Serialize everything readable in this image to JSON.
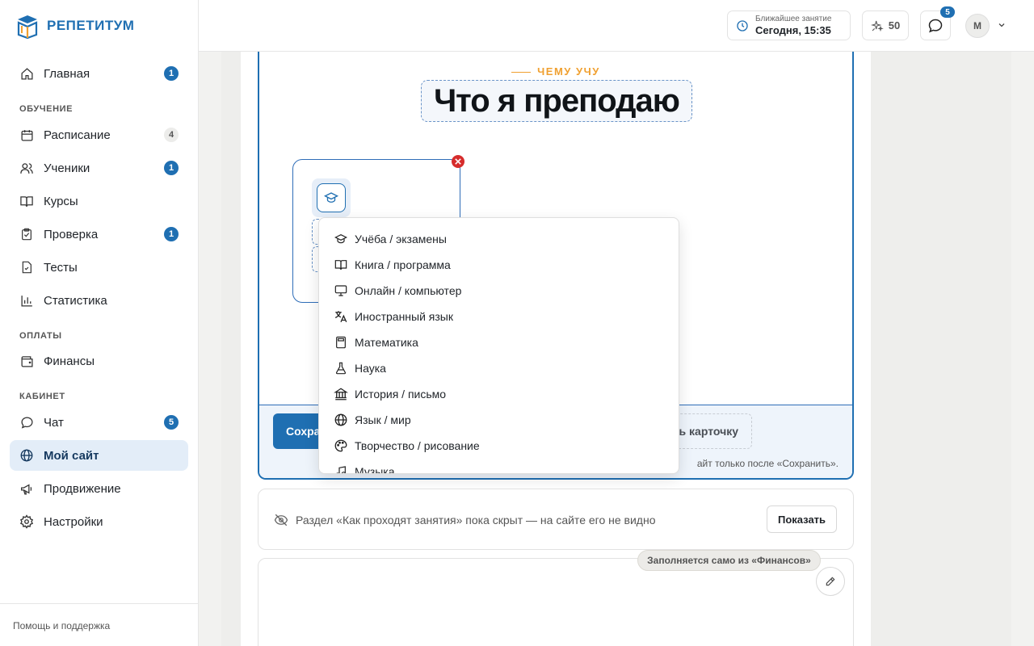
{
  "app": {
    "name": "РЕПЕТИТУМ",
    "logo_icon": "book-graduation-logo"
  },
  "sidebar": {
    "items": [
      {
        "label": "Главная",
        "icon": "home-icon",
        "badge": "1"
      },
      {
        "label": "Расписание",
        "icon": "calendar-icon",
        "badge": "4"
      },
      {
        "label": "Ученики",
        "icon": "users-icon",
        "badge": "1"
      },
      {
        "label": "Курсы",
        "icon": "book-icon",
        "badge": ""
      },
      {
        "label": "Проверка",
        "icon": "clipboard-check-icon",
        "badge": "1"
      },
      {
        "label": "Тесты",
        "icon": "test-file-icon",
        "badge": ""
      },
      {
        "label": "Статистика",
        "icon": "bar-chart-icon",
        "badge": ""
      },
      {
        "label": "Финансы",
        "icon": "wallet-icon",
        "badge": ""
      },
      {
        "label": "Чат",
        "icon": "chat-icon",
        "badge": "5"
      },
      {
        "label": "Мой сайт",
        "icon": "globe-icon",
        "badge": ""
      },
      {
        "label": "Продвижение",
        "icon": "megaphone-icon",
        "badge": ""
      },
      {
        "label": "Настройки",
        "icon": "gear-icon",
        "badge": ""
      }
    ],
    "sections": {
      "learning": "ОБУЧЕНИЕ",
      "payments": "ОПЛАТЫ",
      "cabinet": "КАБИНЕТ"
    },
    "footer": "Помощь и поддержка",
    "active": "Мой сайт"
  },
  "topbar": {
    "next_lesson_label": "Ближайшее занятие",
    "next_lesson_value": "Сегодня, 15:35",
    "points": "50",
    "chat_badge": "5",
    "avatar_initial": "М"
  },
  "editor": {
    "eyebrow": "ЧЕМУ УЧУ",
    "heading": "Что я преподаю",
    "save_label": "Сохранить",
    "save_label_visible": "Сохра",
    "add_card_label": "ь карточку",
    "footer_note": "айт только после «Сохранить»."
  },
  "icon_menu": {
    "items": [
      {
        "label": "Учёба / экзамены",
        "icon": "graduation-cap-icon"
      },
      {
        "label": "Книга / программа",
        "icon": "open-book-icon"
      },
      {
        "label": "Онлайн / компьютер",
        "icon": "monitor-icon"
      },
      {
        "label": "Иностранный язык",
        "icon": "translate-icon"
      },
      {
        "label": "Математика",
        "icon": "calculator-icon"
      },
      {
        "label": "Наука",
        "icon": "flask-icon"
      },
      {
        "label": "История / письмо",
        "icon": "landmark-icon"
      },
      {
        "label": "Язык / мир",
        "icon": "globe-icon"
      },
      {
        "label": "Творчество / рисование",
        "icon": "palette-icon"
      },
      {
        "label": "Музыка",
        "icon": "music-note-icon"
      }
    ]
  },
  "hidden_section": {
    "text": "Раздел «Как проходят занятия» пока скрыт — на сайте его не видно",
    "show_label": "Показать"
  },
  "prices_section": {
    "auto_tag": "Заполняется само из «Финансов»"
  },
  "colors": {
    "brand": "#1f6fb2",
    "accent": "#f0a030",
    "danger": "#d62c2c"
  }
}
